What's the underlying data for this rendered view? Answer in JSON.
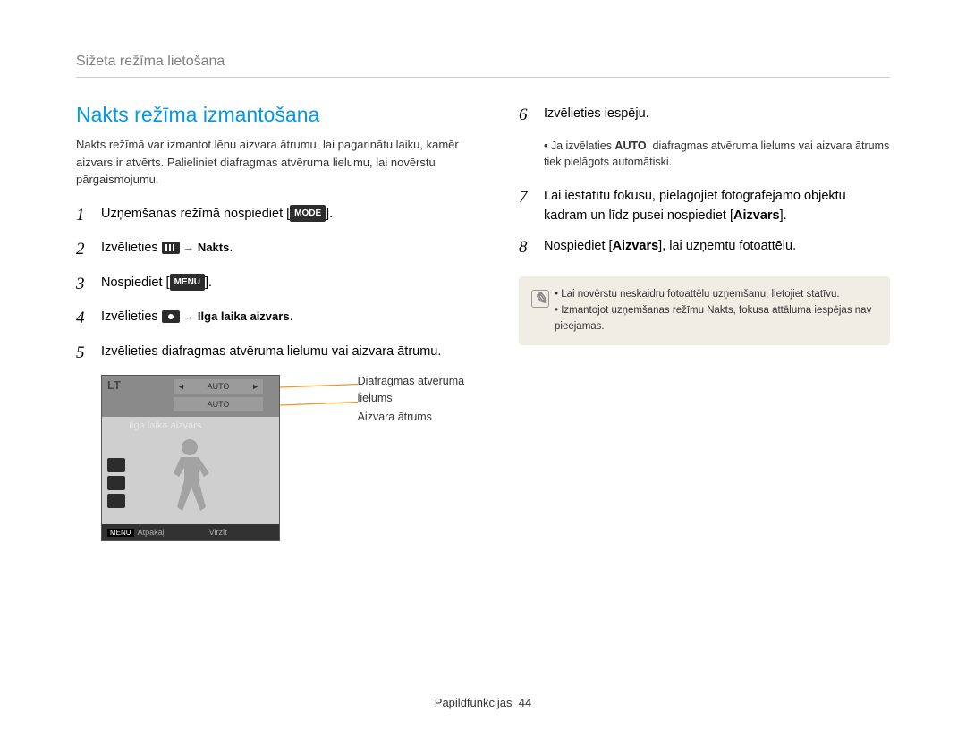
{
  "breadcrumb": "Sižeta režīma lietošana",
  "title": "Nakts režīma izmantošana",
  "intro": "Nakts režīmā var izmantot lēnu aizvara ātrumu, lai pagarinātu laiku, kamēr aizvars ir atvērts. Palieliniet diafragmas atvēruma lielumu, lai novērstu pārgaismojumu.",
  "left_steps": [
    {
      "n": "1",
      "pre": "Uzņemšanas režīmā nospiediet [",
      "icon": "MODE",
      "post": "]."
    },
    {
      "n": "2",
      "pre": "Izvēlieties ",
      "icon": "scene",
      "post_b": " → Nakts",
      "tail": "."
    },
    {
      "n": "3",
      "pre": "Nospiediet [",
      "icon": "MENU",
      "post": "]."
    },
    {
      "n": "4",
      "pre": "Izvēlieties ",
      "icon": "camera",
      "post_b": " → Ilga laika aizvars",
      "tail": "."
    },
    {
      "n": "5",
      "text": "Izvēlieties diafragmas atvēruma lielumu vai aizvara ātrumu."
    }
  ],
  "callouts": {
    "aperture": "Diafragmas atvēruma lielums",
    "shutter": "Aizvara ātrums"
  },
  "camera_ui": {
    "badge": "LT",
    "row1": "AUTO",
    "row2": "AUTO",
    "strip": "Ilga laika aizvars",
    "back": "Atpakaļ",
    "move": "Virzīt",
    "menu": "MENU"
  },
  "right_steps": [
    {
      "n": "6",
      "text": "Izvēlieties iespēju."
    },
    {
      "n": "7",
      "html": "Lai iestatītu fokusu, pielāgojiet fotografējamo objektu kadram un līdz pusei nospiediet [",
      "b": "Aizvars",
      "tail": "]."
    },
    {
      "n": "8",
      "html": "Nospiediet [",
      "b": "Aizvars",
      "tail": "], lai uzņemtu fotoattēlu."
    }
  ],
  "sub_note_6_pre": "Ja izvēlaties ",
  "sub_note_6_b": "AUTO",
  "sub_note_6_post": ", diafragmas atvēruma lielums vai aizvara ātrums tiek pielāgots automātiski.",
  "info_box": [
    "Lai novērstu neskaidru fotoattēlu uzņemšanu, lietojiet statīvu.",
    "Izmantojot uzņemšanas režīmu Nakts, fokusa attāluma iespējas nav pieejamas."
  ],
  "footer": {
    "label": "Papildfunkcijas",
    "page": "44"
  }
}
